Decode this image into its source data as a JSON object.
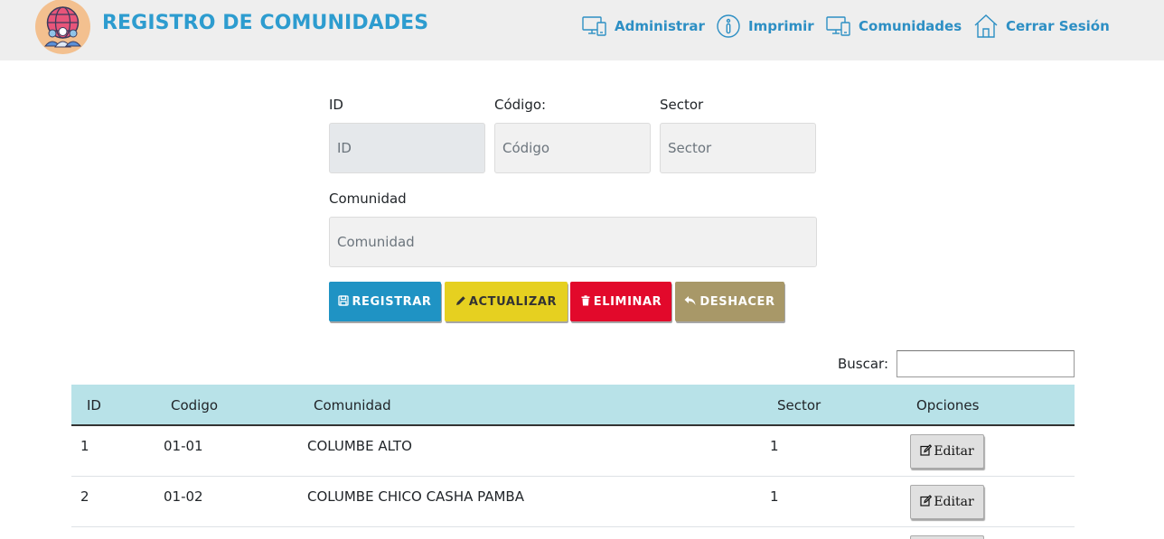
{
  "header": {
    "title": "REGISTRO DE COMUNIDADES",
    "nav": {
      "administrar": "Administrar",
      "imprimir": "Imprimir",
      "comunidades": "Comunidades",
      "cerrar_sesion": "Cerrar Sesión"
    }
  },
  "form": {
    "id_label": "ID",
    "id_placeholder": "ID",
    "codigo_label": "Código:",
    "codigo_placeholder": "Código",
    "sector_label": "Sector",
    "sector_placeholder": "Sector",
    "comunidad_label": "Comunidad",
    "comunidad_placeholder": "Comunidad"
  },
  "buttons": {
    "registrar": "REGISTRAR",
    "actualizar": "ACTUALIZAR",
    "eliminar": "ELIMINAR",
    "deshacer": "DESHACER"
  },
  "search": {
    "label": "Buscar:",
    "value": ""
  },
  "table": {
    "headers": {
      "id": "ID",
      "codigo": "Codigo",
      "comunidad": "Comunidad",
      "sector": "Sector",
      "opciones": "Opciones"
    },
    "rows": [
      {
        "id": "1",
        "codigo": "01-01",
        "comunidad": "COLUMBE ALTO",
        "sector": "1",
        "action": "Editar"
      },
      {
        "id": "2",
        "codigo": "01-02",
        "comunidad": "COLUMBE CHICO CASHA PAMBA",
        "sector": "1",
        "action": "Editar"
      }
    ]
  },
  "colors": {
    "brand": "#2d9ccf",
    "registrar": "#1f93c4",
    "actualizar": "#e6d020",
    "eliminar": "#e2092b",
    "deshacer": "#a89868",
    "table_header": "#b8e2e8"
  }
}
